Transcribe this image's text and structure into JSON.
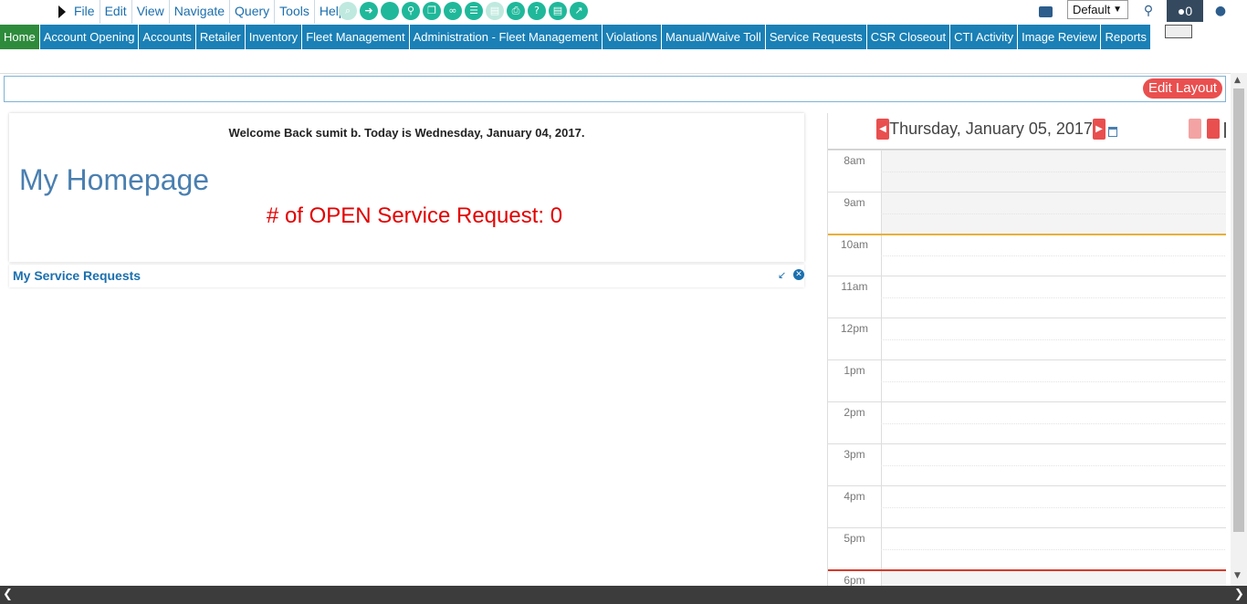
{
  "menu": {
    "items": [
      "File",
      "Edit",
      "View",
      "Navigate",
      "Query",
      "Tools",
      "Help"
    ]
  },
  "toolbar": {
    "icons": [
      "search-icon",
      "go-icon",
      "circle-icon",
      "key-icon",
      "copy-icon",
      "link-icon",
      "list-icon",
      "notepad-icon",
      "print-icon",
      "help-icon",
      "report-icon",
      "chart-icon"
    ],
    "layout_value": "Default",
    "notification_count": "0"
  },
  "nav": {
    "tabs": [
      "Home",
      "Account Opening",
      "Accounts",
      "Retailer",
      "Inventory",
      "Fleet Management",
      "Administration - Fleet Management",
      "Violations",
      "Manual/Waive Toll",
      "Service Requests",
      "CSR Closeout",
      "CTI Activity",
      "Image Review",
      "Reports"
    ],
    "active": "Home"
  },
  "layout": {
    "edit_label": "Edit Layout"
  },
  "welcome": {
    "text": "Welcome Back sumit b.  Today is Wednesday, January 04, 2017.",
    "title": "My Homepage",
    "open_requests": "# of OPEN Service Request: 0"
  },
  "service_requests": {
    "title": "My Service Requests"
  },
  "calendar": {
    "date": "Thursday, January 05, 2017",
    "hours": [
      "8am",
      "9am",
      "10am",
      "11am",
      "12pm",
      "1pm",
      "2pm",
      "3pm",
      "4pm",
      "5pm",
      "6pm"
    ],
    "colors": {
      "work_start_line": "#e8b03a",
      "work_end_line": "#d63a2a",
      "nav_button": "#e94f4f"
    }
  },
  "colors": {
    "nav_tab": "#1a80b6",
    "nav_active": "#2e8b3c",
    "accent_text": "#1b6fae",
    "alert": "#e30000"
  }
}
